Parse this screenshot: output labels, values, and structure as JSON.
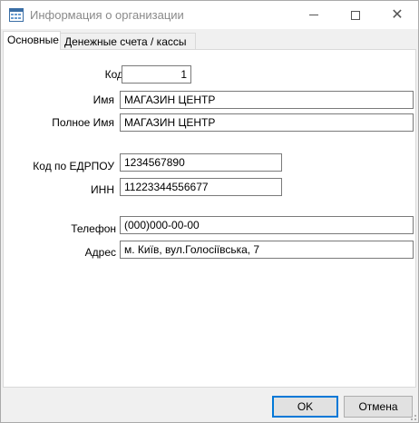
{
  "window": {
    "title": "Информация о организации"
  },
  "tabs": [
    {
      "label": "Основные"
    },
    {
      "label": "Денежные счета / кассы"
    }
  ],
  "form": {
    "code": {
      "label": "Код",
      "value": "1"
    },
    "name": {
      "label": "Имя",
      "value": "МАГАЗИН ЦЕНТР"
    },
    "full_name": {
      "label": "Полное Имя",
      "value": "МАГАЗИН ЦЕНТР"
    },
    "edrpou": {
      "label": "Код по ЕДРПОУ",
      "value": "1234567890"
    },
    "inn": {
      "label": "ИНН",
      "value": "11223344556677"
    },
    "phone": {
      "label": "Телефон",
      "value": "(000)000-00-00"
    },
    "address": {
      "label": "Адрес",
      "value": "м. Київ, вул.Голосіївська, 7"
    }
  },
  "buttons": {
    "ok": "OK",
    "cancel": "Отмена"
  }
}
